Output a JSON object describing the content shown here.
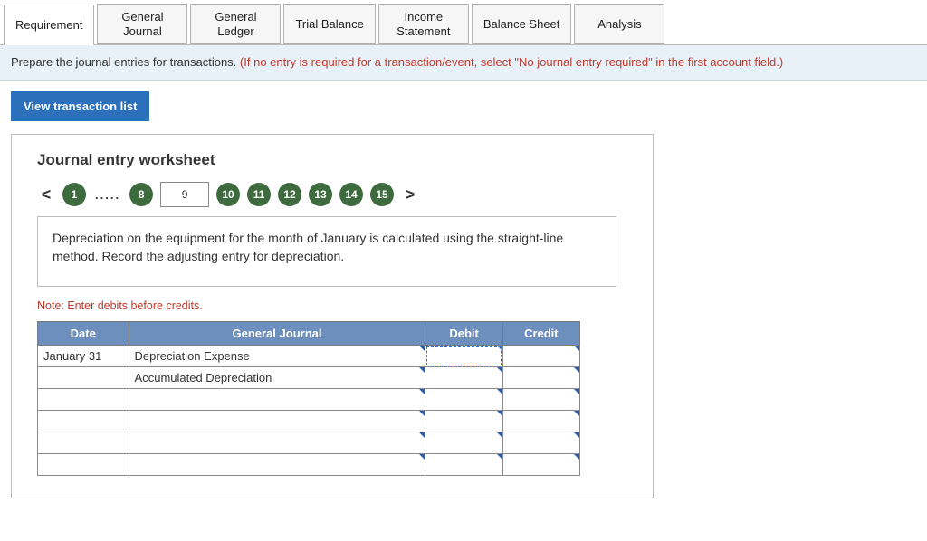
{
  "tabs": [
    {
      "label": "Requirement",
      "active": true
    },
    {
      "label": "General\nJournal",
      "active": false
    },
    {
      "label": "General\nLedger",
      "active": false
    },
    {
      "label": "Trial Balance",
      "active": false
    },
    {
      "label": "Income\nStatement",
      "active": false
    },
    {
      "label": "Balance Sheet",
      "active": false
    },
    {
      "label": "Analysis",
      "active": false
    }
  ],
  "instruction": {
    "main": "Prepare the journal entries for transactions. ",
    "hint": "(If no entry is required for a transaction/event, select \"No journal entry required\" in the first account field.)"
  },
  "view_btn": "View transaction list",
  "worksheet": {
    "title": "Journal entry worksheet",
    "pager": {
      "prev": "<",
      "next": ">",
      "dots": ".....",
      "steps_before_dots": [
        "1"
      ],
      "steps_after_dots": [
        "8"
      ],
      "current": "9",
      "steps_after_current": [
        "10",
        "11",
        "12",
        "13",
        "14",
        "15"
      ]
    },
    "description": "Depreciation on the equipment for the month of January is calculated using the straight-line method. Record the adjusting entry for depreciation.",
    "note": "Note: Enter debits before credits.",
    "table": {
      "headers": {
        "date": "Date",
        "gj": "General Journal",
        "debit": "Debit",
        "credit": "Credit"
      },
      "rows": [
        {
          "date": "January 31",
          "gj": "Depreciation Expense",
          "debit": "",
          "credit": "",
          "debit_selected": true
        },
        {
          "date": "",
          "gj": "Accumulated Depreciation",
          "debit": "",
          "credit": ""
        },
        {
          "date": "",
          "gj": "",
          "debit": "",
          "credit": ""
        },
        {
          "date": "",
          "gj": "",
          "debit": "",
          "credit": ""
        },
        {
          "date": "",
          "gj": "",
          "debit": "",
          "credit": ""
        },
        {
          "date": "",
          "gj": "",
          "debit": "",
          "credit": ""
        }
      ]
    }
  }
}
